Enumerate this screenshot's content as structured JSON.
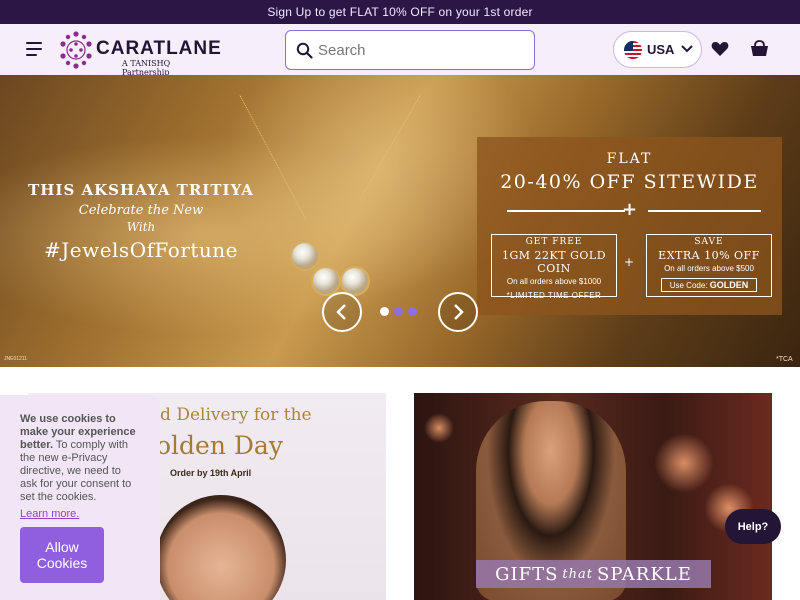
{
  "promo": {
    "text": "Sign Up to get FLAT 10% OFF on your 1st order"
  },
  "header": {
    "brand": "CARATLANE",
    "brand_sub": "A TANISHQ Partnership",
    "search_placeholder": "Search",
    "country": "USA"
  },
  "hero": {
    "left_line1": "THIS AKSHAYA TRITIYA",
    "left_line2": "Celebrate the New",
    "left_line3": "With",
    "left_line4": "#JewelsOfFortune",
    "flat": "FLAT",
    "main_offer": "20-40% OFF SITEWIDE",
    "plus": "+",
    "card1_title": "GET FREE",
    "card1_main": "1GM 22KT GOLD COIN",
    "card1_sub": "On all orders above $1000",
    "card1_note": "*LIMITED TIME OFFER",
    "card2_title": "SAVE",
    "card2_main": "EXTRA 10% OFF",
    "card2_sub": "On all orders above $500",
    "card2_code_prefix": "Use Code:",
    "card2_code": "GOLDEN",
    "fine_left": "JNE01211",
    "fine_right": "*TCA",
    "active_slide": 1
  },
  "tiles": {
    "left_line1": "ed Delivery for the",
    "left_line2": "olden Day",
    "left_line3": "Order by 19th April",
    "right_banner_a": "GIFTS",
    "right_banner_b": "that",
    "right_banner_c": "SPARKLE"
  },
  "cookie": {
    "bold": "We use cookies to make your experience better.",
    "text": " To comply with the new e-Privacy directive, we need to ask for your consent to set the cookies.",
    "link": "Learn more.",
    "button": "Allow Cookies"
  },
  "help": "Help?",
  "colors": {
    "promo_bg": "#2b1646",
    "header_bg": "#f6eef9",
    "brand_purple": "#8b46c8",
    "dot_active": "#ffffff",
    "dot_inactive": "#8f6fe0"
  }
}
